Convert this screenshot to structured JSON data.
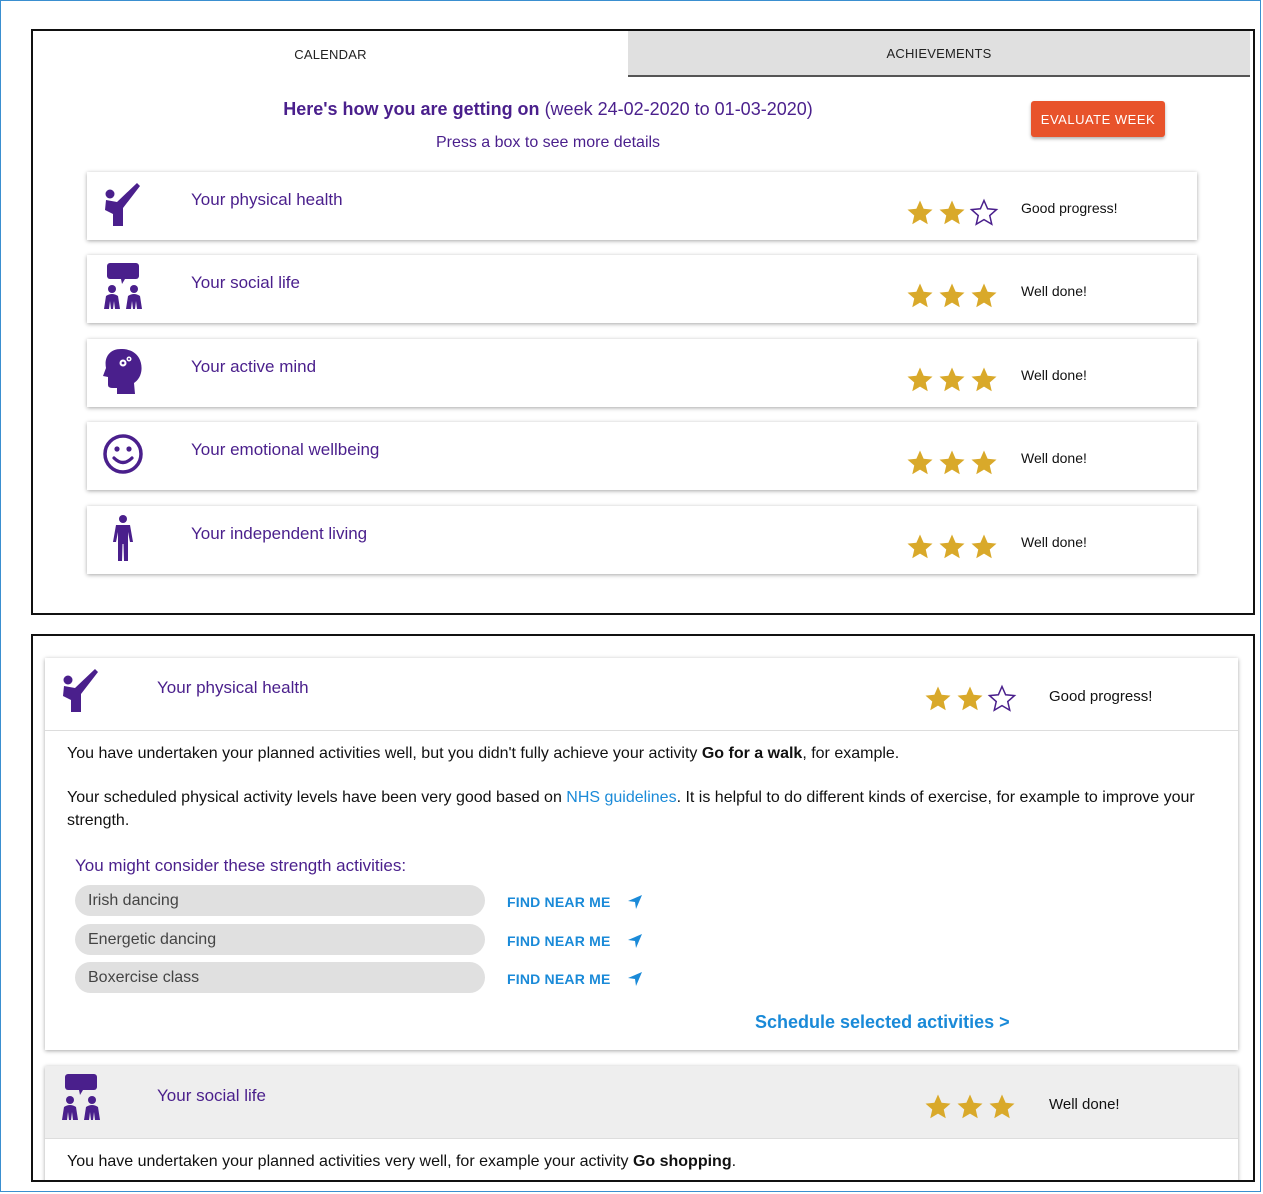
{
  "colors": {
    "purple": "#4a1f8c",
    "star_gold": "#d9a92a",
    "accent_orange": "#e8532b",
    "link_blue": "#1a8ad8"
  },
  "tabs": [
    {
      "label": "CALENDAR",
      "active": true
    },
    {
      "label": "ACHIEVEMENTS",
      "active": false
    }
  ],
  "summary": {
    "title_bold": "Here's how you are getting on",
    "title_rest": " (week 24-02-2020 to 01-03-2020)",
    "hint": "Press a box to see more details",
    "evaluate_label": "EVALUATE WEEK"
  },
  "areas": [
    {
      "label": "Your physical health",
      "icon": "exercise-icon",
      "stars_filled": 2,
      "stars_total": 3,
      "status": "Good progress!"
    },
    {
      "label": "Your social life",
      "icon": "social-icon",
      "stars_filled": 3,
      "stars_total": 3,
      "status": "Well done!"
    },
    {
      "label": "Your active mind",
      "icon": "mind-icon",
      "stars_filled": 3,
      "stars_total": 3,
      "status": "Well done!"
    },
    {
      "label": "Your emotional wellbeing",
      "icon": "smiley-icon",
      "stars_filled": 3,
      "stars_total": 3,
      "status": "Well done!"
    },
    {
      "label": "Your independent living",
      "icon": "person-icon",
      "stars_filled": 3,
      "stars_total": 3,
      "status": "Well done!"
    }
  ],
  "detail_physical": {
    "label": "Your physical health",
    "stars_filled": 2,
    "stars_total": 3,
    "status": "Good progress!",
    "para1_pre": "You have undertaken your planned activities well, but you didn't fully achieve your activity ",
    "para1_bold": "Go for a walk",
    "para1_post": ", for example.",
    "para2_pre": "Your scheduled physical activity levels have been very good based on ",
    "para2_link": "NHS guidelines",
    "para2_post": ". It is helpful to do different kinds of exercise, for example to improve your strength.",
    "consider_title": "You might consider these strength activities:",
    "activities": [
      {
        "name": "Irish dancing",
        "action": "FIND NEAR ME"
      },
      {
        "name": "Energetic dancing",
        "action": "FIND NEAR ME"
      },
      {
        "name": "Boxercise class",
        "action": "FIND NEAR ME"
      }
    ],
    "schedule_label": "Schedule selected activities >"
  },
  "detail_social": {
    "label": "Your social life",
    "stars_filled": 3,
    "stars_total": 3,
    "status": "Well done!",
    "para_pre": "You have undertaken your planned activities very well, for example your activity ",
    "para_bold": "Go shopping",
    "para_post": "."
  }
}
